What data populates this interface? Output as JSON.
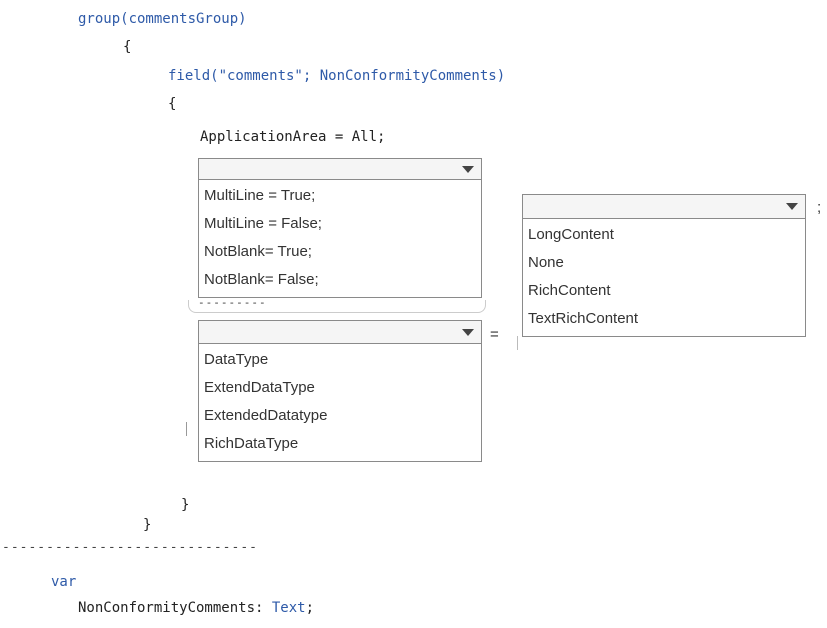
{
  "code": {
    "group_line": "group(commentsGroup)",
    "open_brace_outer": "{",
    "field_line": "field(\"comments\"; NonConformityComments)",
    "open_brace_inner": "{",
    "application_area_line": "ApplicationArea = All;",
    "close_brace_inner": "}",
    "close_brace_outer": "}",
    "separator": "-----------------------------",
    "var_keyword": "var",
    "var_decl_name": "NonConformityComments: ",
    "var_decl_type": "Text",
    "var_decl_end": ";"
  },
  "dropdown_property": {
    "selected": "",
    "options": [
      "MultiLine = True;",
      "MultiLine = False;",
      "NotBlank= True;",
      "NotBlank= False;"
    ]
  },
  "dropdown_value": {
    "selected": "",
    "trailing": ";",
    "options": [
      "LongContent",
      "None",
      "RichContent",
      "TextRichContent"
    ]
  },
  "dropdown_datatype": {
    "selected": "",
    "trailing": "=",
    "options": [
      "DataType",
      "ExtendDataType",
      "ExtendedDatatype",
      "RichDataType"
    ]
  },
  "dashes_mid": "---------"
}
